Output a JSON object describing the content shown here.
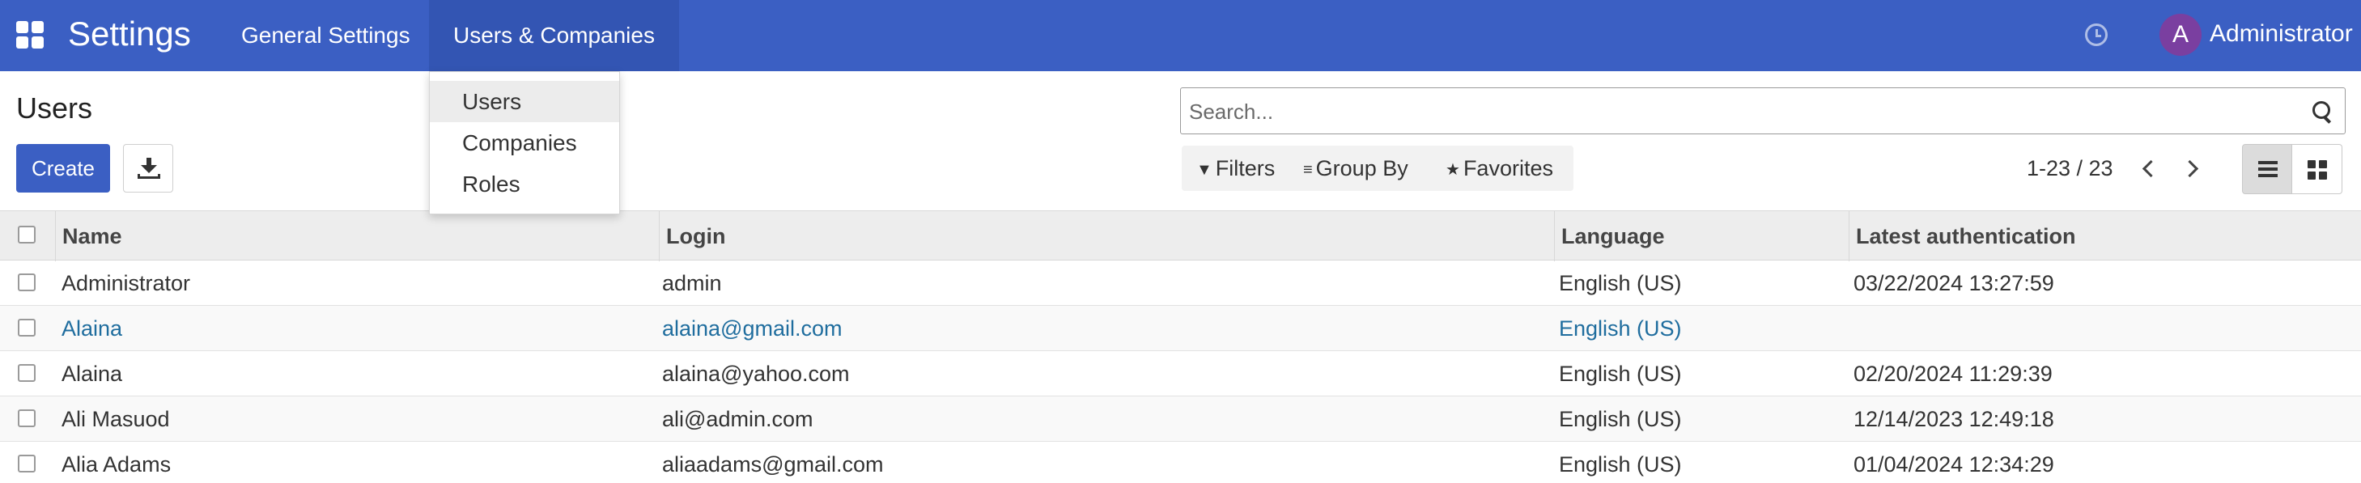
{
  "navbar": {
    "app_name": "Settings",
    "menu": [
      "General Settings",
      "Users & Companies"
    ],
    "user_initial": "A",
    "user_name": "Administrator"
  },
  "dropdown": {
    "items": [
      "Users",
      "Companies",
      "Roles"
    ],
    "active": "Users"
  },
  "control_panel": {
    "title": "Users",
    "create_label": "Create",
    "search_placeholder": "Search...",
    "filters_label": "Filters",
    "group_by_label": "Group By",
    "favorites_label": "Favorites",
    "pager": "1-23 / 23",
    "active_view": "list"
  },
  "table": {
    "columns": [
      "Name",
      "Login",
      "Language",
      "Latest authentication"
    ],
    "rows": [
      {
        "name": "Administrator",
        "login": "admin",
        "language": "English (US)",
        "latest_auth": "03/22/2024 13:27:59"
      },
      {
        "name": "Alaina",
        "login": "alaina@gmail.com",
        "language": "English (US)",
        "latest_auth": ""
      },
      {
        "name": "Alaina",
        "login": "alaina@yahoo.com",
        "language": "English (US)",
        "latest_auth": "02/20/2024 11:29:39"
      },
      {
        "name": "Ali Masuod",
        "login": "ali@admin.com",
        "language": "English (US)",
        "latest_auth": "12/14/2023 12:49:18"
      },
      {
        "name": "Alia Adams",
        "login": "aliaadams@gmail.com",
        "language": "English (US)",
        "latest_auth": "01/04/2024 12:34:29"
      }
    ]
  },
  "colors": {
    "navbar": "#3b5fc3",
    "primary_button": "#3b5fc3",
    "avatar": "#7a3fa0",
    "link_text": "#1f6d9e"
  }
}
